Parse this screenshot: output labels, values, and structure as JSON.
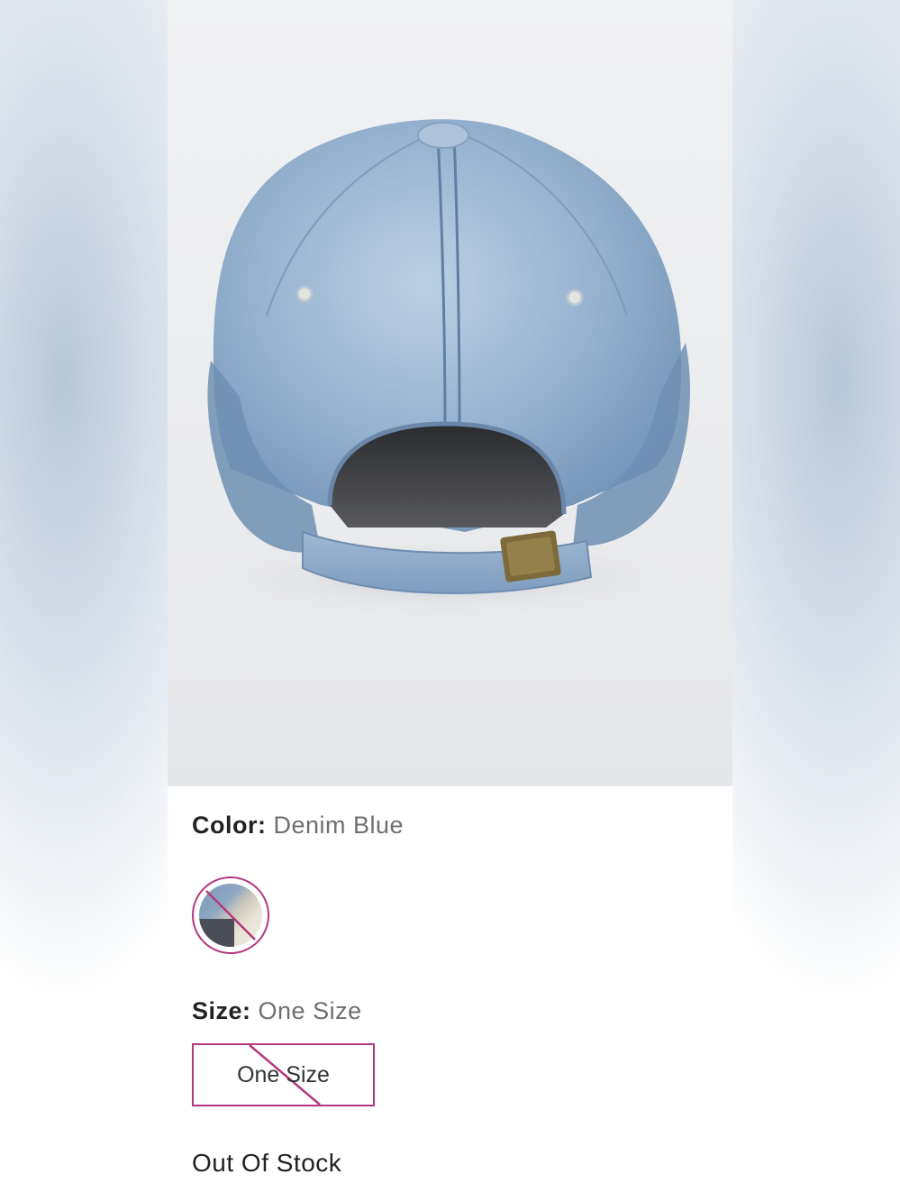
{
  "product": {
    "image_alt": "denim baseball cap back view",
    "color_label": "Color:",
    "color_value": "Denim Blue",
    "size_label": "Size:",
    "size_value": "One Size",
    "size_option": "One Size",
    "stock_status": "Out Of Stock"
  },
  "colors": {
    "accent": "#b4387c",
    "denim": "#8aa5c4"
  }
}
